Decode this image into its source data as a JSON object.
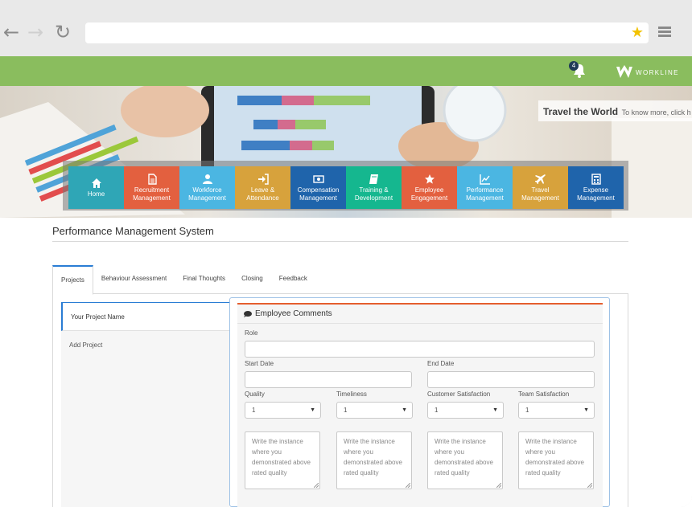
{
  "browser": {
    "back_icon": "back-arrow-icon",
    "forward_icon": "forward-arrow-icon",
    "reload_icon": "reload-icon",
    "url": "",
    "star_icon": "star-icon",
    "menu_icon": "hamburger-icon"
  },
  "appbar": {
    "notification_count": "4",
    "logo_text": "WORKLINE",
    "color": "#8abd5e"
  },
  "hero": {
    "banner_title": "Travel the World",
    "banner_sub": "To know more, click h"
  },
  "modules": [
    {
      "label": "Home",
      "icon": "home-icon",
      "color": "#2fa6b6"
    },
    {
      "label": "Recruitment\nManagement",
      "icon": "document-icon",
      "color": "#e3603f"
    },
    {
      "label": "Workforce\nManagement",
      "icon": "user-icon",
      "color": "#4bb6e2"
    },
    {
      "label": "Leave &\nAttendance",
      "icon": "sign-in-icon",
      "color": "#d7a23c"
    },
    {
      "label": "Compensation\nManagement",
      "icon": "money-icon",
      "color": "#1f64ab"
    },
    {
      "label": "Training &\nDevelopment",
      "icon": "book-icon",
      "color": "#15b78f"
    },
    {
      "label": "Employee\nEngagement",
      "icon": "star-icon",
      "color": "#e3603f"
    },
    {
      "label": "Performance\nManagement",
      "icon": "line-chart-icon",
      "color": "#4bb6e2"
    },
    {
      "label": "Travel\nManagement",
      "icon": "plane-icon",
      "color": "#d7a23c"
    },
    {
      "label": "Expense\nManagement",
      "icon": "calculator-icon",
      "color": "#1f64ab"
    }
  ],
  "page": {
    "title": "Performance Management System"
  },
  "tabs": [
    {
      "label": "Projects",
      "active": true
    },
    {
      "label": "Behaviour Assessment",
      "active": false
    },
    {
      "label": "Final Thoughts",
      "active": false
    },
    {
      "label": "Closing",
      "active": false
    },
    {
      "label": "Feedback",
      "active": false
    }
  ],
  "sidebar": {
    "items": [
      {
        "label": "Your Project Name",
        "active": true
      },
      {
        "label": "Add Project",
        "active": false
      }
    ]
  },
  "form": {
    "header": "Employee Comments",
    "role_label": "Role",
    "role_value": "",
    "start_date_label": "Start Date",
    "start_date_value": "",
    "end_date_label": "End Date",
    "end_date_value": "",
    "ratings": [
      {
        "label": "Quality",
        "value": "1"
      },
      {
        "label": "Timeliness",
        "value": "1"
      },
      {
        "label": "Customer Satisfaction",
        "value": "1"
      },
      {
        "label": "Team Satisfaction",
        "value": "1"
      }
    ],
    "textarea_placeholder": "Write the instance where you demonstrated above rated quality"
  }
}
